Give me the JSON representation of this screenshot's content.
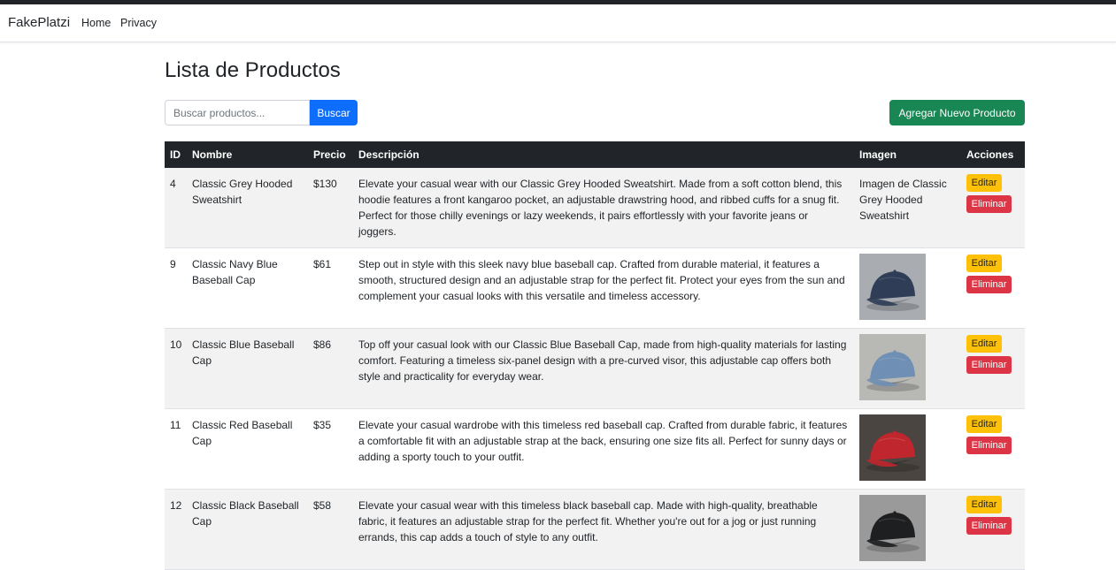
{
  "navbar": {
    "brand": "FakePlatzi",
    "links": [
      "Home",
      "Privacy"
    ]
  },
  "page": {
    "title": "Lista de Productos"
  },
  "search": {
    "placeholder": "Buscar productos...",
    "value": "",
    "button": "Buscar"
  },
  "add_button": "Agregar Nuevo Producto",
  "table": {
    "headers": [
      "ID",
      "Nombre",
      "Precio",
      "Descripción",
      "Imagen",
      "Acciones"
    ],
    "actions": {
      "edit": "Editar",
      "delete": "Eliminar"
    },
    "rows": [
      {
        "id": "4",
        "name": "Classic Grey Hooded Sweatshirt",
        "price": "$130",
        "description": "Elevate your casual wear with our Classic Grey Hooded Sweatshirt. Made from a soft cotton blend, this hoodie features a front kangaroo pocket, an adjustable drawstring hood, and ribbed cuffs for a snug fit. Perfect for those chilly evenings or lazy weekends, it pairs effortlessly with your favorite jeans or joggers.",
        "image_alt": "Imagen de Classic Grey Hooded Sweatshirt",
        "image": "broken"
      },
      {
        "id": "9",
        "name": "Classic Navy Blue Baseball Cap",
        "price": "$61",
        "description": "Step out in style with this sleek navy blue baseball cap. Crafted from durable material, it features a smooth, structured design and an adjustable strap for the perfect fit. Protect your eyes from the sun and complement your casual looks with this versatile and timeless accessory.",
        "image": "navy-cap",
        "cap_color": "#2f3d57",
        "bg_color": "#a9adb1"
      },
      {
        "id": "10",
        "name": "Classic Blue Baseball Cap",
        "price": "$86",
        "description": "Top off your casual look with our Classic Blue Baseball Cap, made from high-quality materials for lasting comfort. Featuring a timeless six-panel design with a pre-curved visor, this adjustable cap offers both style and practicality for everyday wear.",
        "image": "blue-cap",
        "cap_color": "#6f8fb4",
        "bg_color": "#b8b8b5"
      },
      {
        "id": "11",
        "name": "Classic Red Baseball Cap",
        "price": "$35",
        "description": "Elevate your casual wardrobe with this timeless red baseball cap. Crafted from durable fabric, it features a comfortable fit with an adjustable strap at the back, ensuring one size fits all. Perfect for sunny days or adding a sporty touch to your outfit.",
        "image": "red-cap",
        "cap_color": "#c0262d",
        "bg_color": "#4a4540"
      },
      {
        "id": "12",
        "name": "Classic Black Baseball Cap",
        "price": "$58",
        "description": "Elevate your casual wear with this timeless black baseball cap. Made with high-quality, breathable fabric, it features an adjustable strap for the perfect fit. Whether you're out for a jog or just running errands, this cap adds a touch of style to any outfit.",
        "image": "black-cap",
        "cap_color": "#1e1f21",
        "bg_color": "#9a9a9a"
      }
    ]
  }
}
